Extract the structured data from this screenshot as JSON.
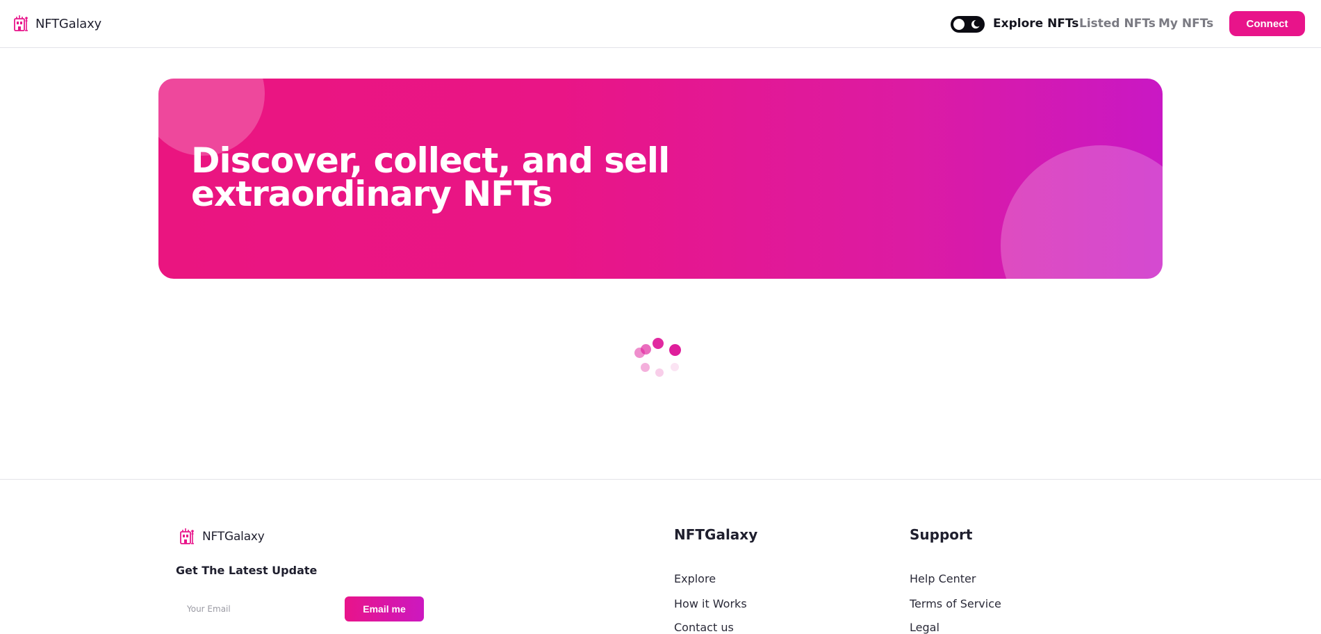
{
  "header": {
    "brand": "NFTGalaxy",
    "nav": {
      "explore": "Explore NFTs",
      "listed": "Listed NFTs",
      "mine": "My NFTs"
    },
    "connect_label": "Connect",
    "theme_toggle_icon": "moon-icon"
  },
  "hero": {
    "title_line1": "Discover, collect, and sell",
    "title_line2": "extraordinary NFTs"
  },
  "loading": {
    "icon": "spinner-icon"
  },
  "footer": {
    "brand": "NFTGalaxy",
    "newsletter_title": "Get The Latest Update",
    "email_placeholder": "Your Email",
    "email_button": "Email me",
    "col1": {
      "title": "NFTGalaxy",
      "links": [
        "Explore",
        "How it Works",
        "Contact us"
      ]
    },
    "col2": {
      "title": "Support",
      "links": [
        "Help Center",
        "Terms of Service",
        "Legal"
      ]
    }
  },
  "colors": {
    "accent": "#e8148a",
    "accent_purple": "#c918c4",
    "text": "#1f1f2e",
    "muted": "#7a7a82"
  }
}
